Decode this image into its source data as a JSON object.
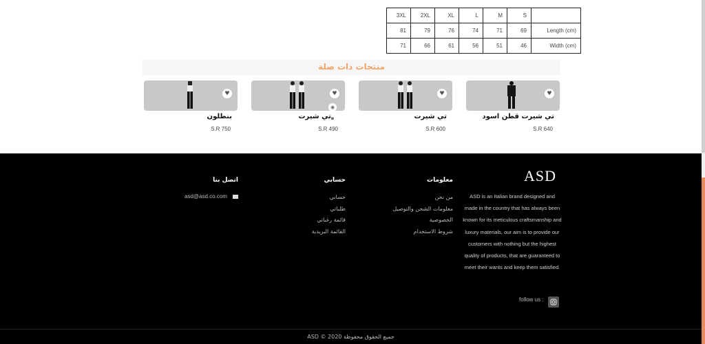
{
  "size_table": {
    "header": [
      "3XL",
      "2XL",
      "XL",
      "L",
      "M",
      "S",
      ""
    ],
    "rows": [
      [
        "81",
        "79",
        "76",
        "74",
        "71",
        "69",
        "Length (cm)"
      ],
      [
        "71",
        "66",
        "61",
        "56",
        "51",
        "46",
        "Width (cm)"
      ]
    ]
  },
  "related": {
    "title": "منتجات ذات صلة",
    "products": [
      {
        "name": "بنطلون",
        "price": "S.R 750"
      },
      {
        "name": "تي شيرت",
        "price": "S.R 490"
      },
      {
        "name": "تي شيرت",
        "price": "S.R 600"
      },
      {
        "name": "تي شيرت قطن اسود",
        "price": "S.R 640"
      }
    ],
    "wishlist_icon": "heart-icon",
    "quickview_icon": "eye-icon",
    "cart_icon": "cart-icon"
  },
  "footer": {
    "logo": "ASD",
    "about": "ASD is an Italian brand designed and made in the country that has always been known for its meticulous craftsmanship and luxury materials, our aim is to provide our customers with nothing but the highest quality of products, that are guaranteed to meet their wants and keep them satisfied.",
    "follow_label": "follow us :",
    "info": {
      "title": "معلومات",
      "items": [
        "من نحن",
        "معلومات الشحن والتوصيل",
        "الخصوصية",
        "شروط الاستخدام"
      ]
    },
    "account": {
      "title": "حسابي",
      "items": [
        "حسابي",
        "طلباتي",
        "قائمة رغباتي",
        "القائمة البريدية"
      ]
    },
    "contact": {
      "title": "اتصل بنا",
      "email": "asd@asd.co.com"
    },
    "copyright": "جميع الحقوق محفوظة 2020 © ASD"
  },
  "colors": {
    "accent": "#f2a469",
    "footer_bg": "#000000",
    "card_bg": "#c8c8c8"
  }
}
